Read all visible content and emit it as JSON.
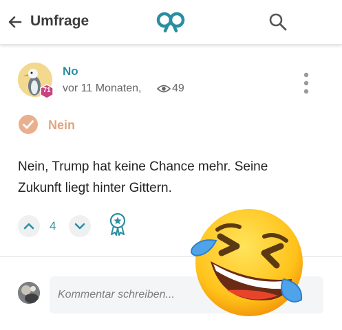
{
  "header": {
    "title": "Umfrage",
    "back_icon": "arrow-left-icon",
    "logo_icon": "app-logo-icon",
    "search_icon": "search-icon"
  },
  "post": {
    "author": "No",
    "avatar_icon": "seagull-avatar-icon",
    "level_badge": "71",
    "time": "vor 11 Monaten,",
    "views": "49",
    "answer": "Nein",
    "text": "Nein, Trump hat keine Chance mehr. Seine Zukunft liegt hinter Gittern.",
    "votes": "4"
  },
  "comment": {
    "placeholder": "Kommentar schreiben..."
  },
  "overlay": {
    "emoji_icon": "tears-of-joy-emoji"
  },
  "colors": {
    "accent": "#2a8ea0",
    "answer": "#e0a67f",
    "badge": "#c9417d"
  }
}
